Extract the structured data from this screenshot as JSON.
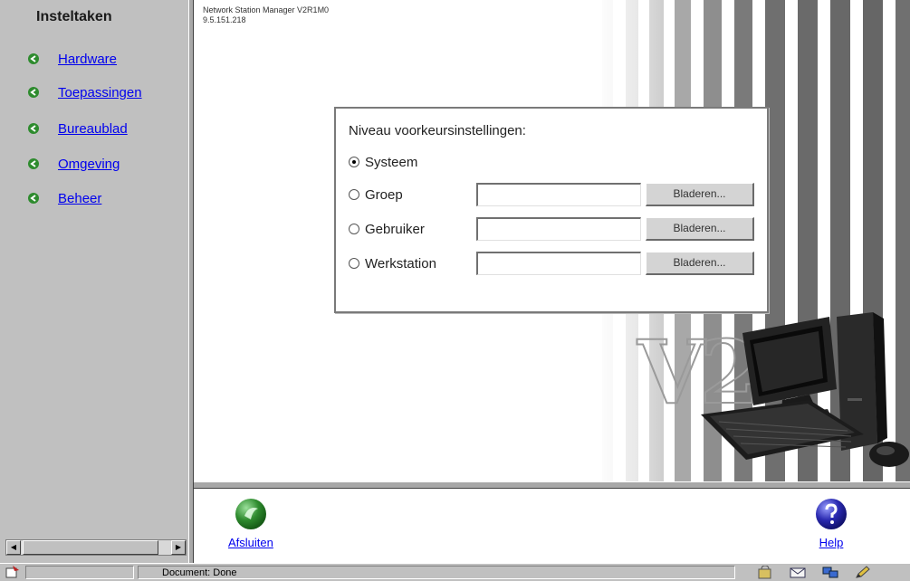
{
  "nav": {
    "title": "Insteltaken",
    "items": [
      {
        "label": "Hardware"
      },
      {
        "label": "Toepassingen"
      },
      {
        "label": "Bureaublad"
      },
      {
        "label": "Omgeving"
      },
      {
        "label": "Beheer"
      }
    ]
  },
  "main": {
    "version_line1": "Network Station Manager V2R1M0",
    "version_line2": "9.5.151.218",
    "logo_text": "V2"
  },
  "preferences": {
    "title": "Niveau voorkeursinstellingen:",
    "options": [
      {
        "label": "Systeem",
        "checked": true
      },
      {
        "label": "Groep",
        "checked": false,
        "input_value": "",
        "browse_label": "Bladeren..."
      },
      {
        "label": "Gebruiker",
        "checked": false,
        "input_value": "",
        "browse_label": "Bladeren..."
      },
      {
        "label": "Werkstation",
        "checked": false,
        "input_value": "",
        "browse_label": "Bladeren..."
      }
    ]
  },
  "toolbar": {
    "exit_label": "Afsluiten",
    "help_label": "Help"
  },
  "statusbar": {
    "text": "Document: Done"
  },
  "colors": {
    "link": "#0000ee",
    "nav_bg": "#c0c0c0",
    "bullet_green": "#2e8b2e",
    "help_blue": "#1a1aa0"
  }
}
